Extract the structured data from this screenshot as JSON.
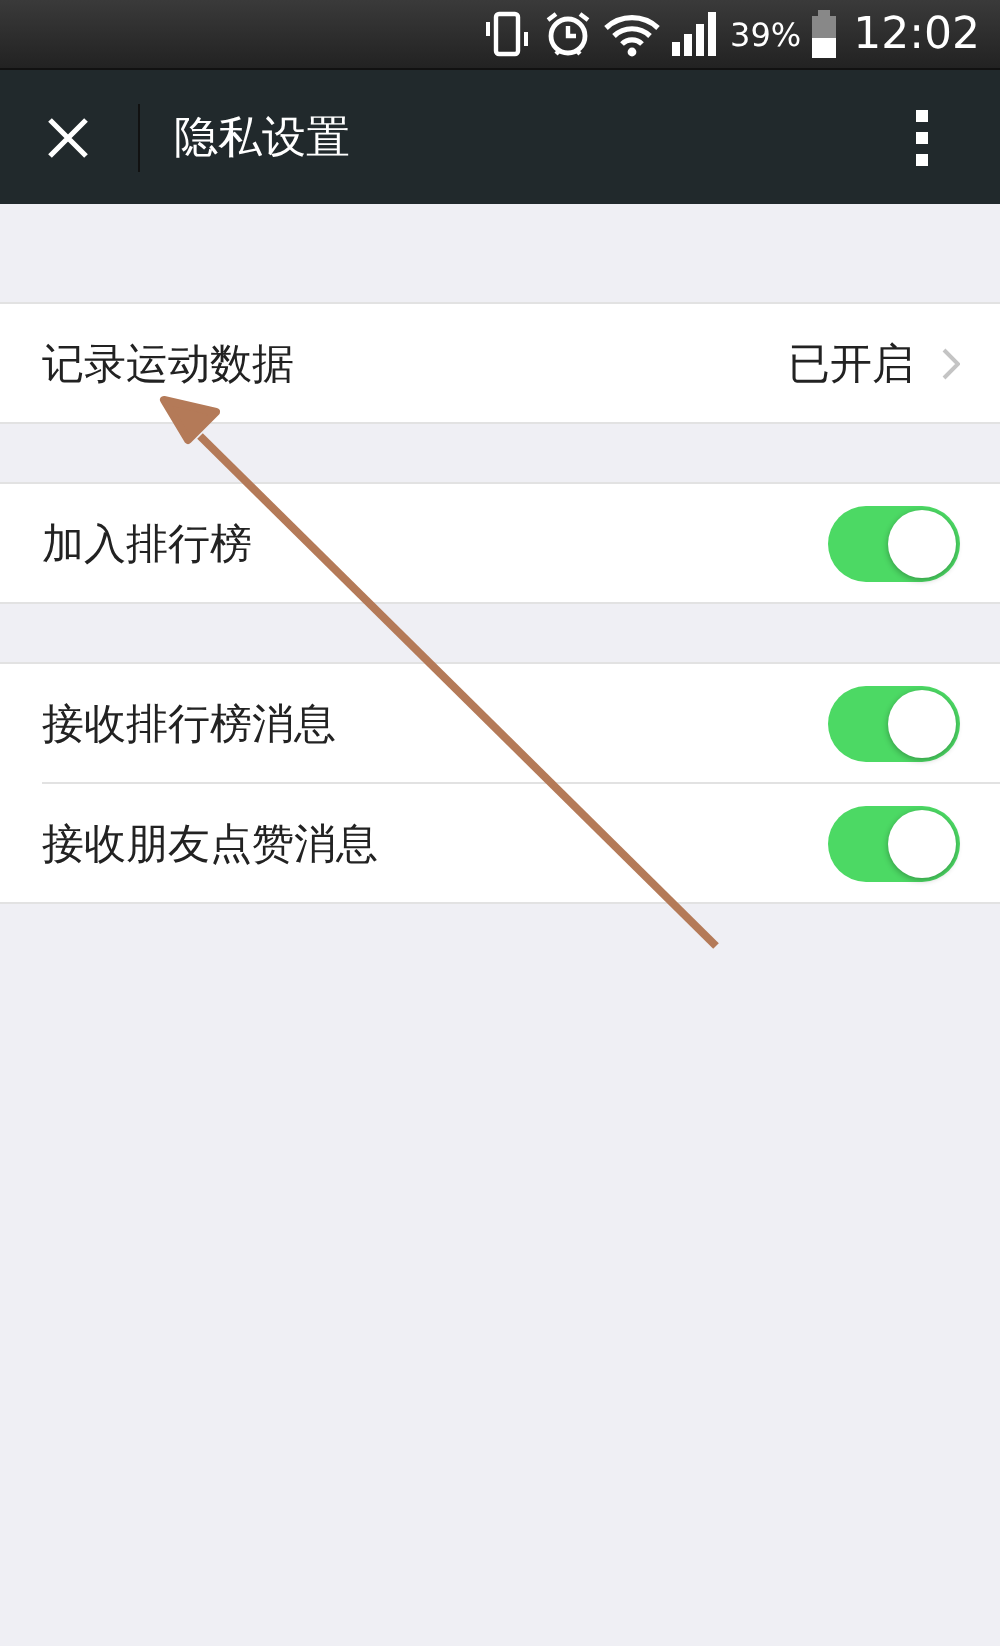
{
  "status_bar": {
    "battery": "39%",
    "time": "12:02"
  },
  "toolbar": {
    "title": "隐私设置"
  },
  "sections": [
    {
      "items": [
        {
          "kind": "link",
          "label": "记录运动数据",
          "value": "已开启"
        }
      ]
    },
    {
      "items": [
        {
          "kind": "toggle",
          "label": "加入排行榜",
          "on": true
        }
      ]
    },
    {
      "items": [
        {
          "kind": "toggle",
          "label": "接收排行榜消息",
          "on": true
        },
        {
          "kind": "toggle",
          "label": "接收朋友点赞消息",
          "on": true
        }
      ]
    }
  ]
}
